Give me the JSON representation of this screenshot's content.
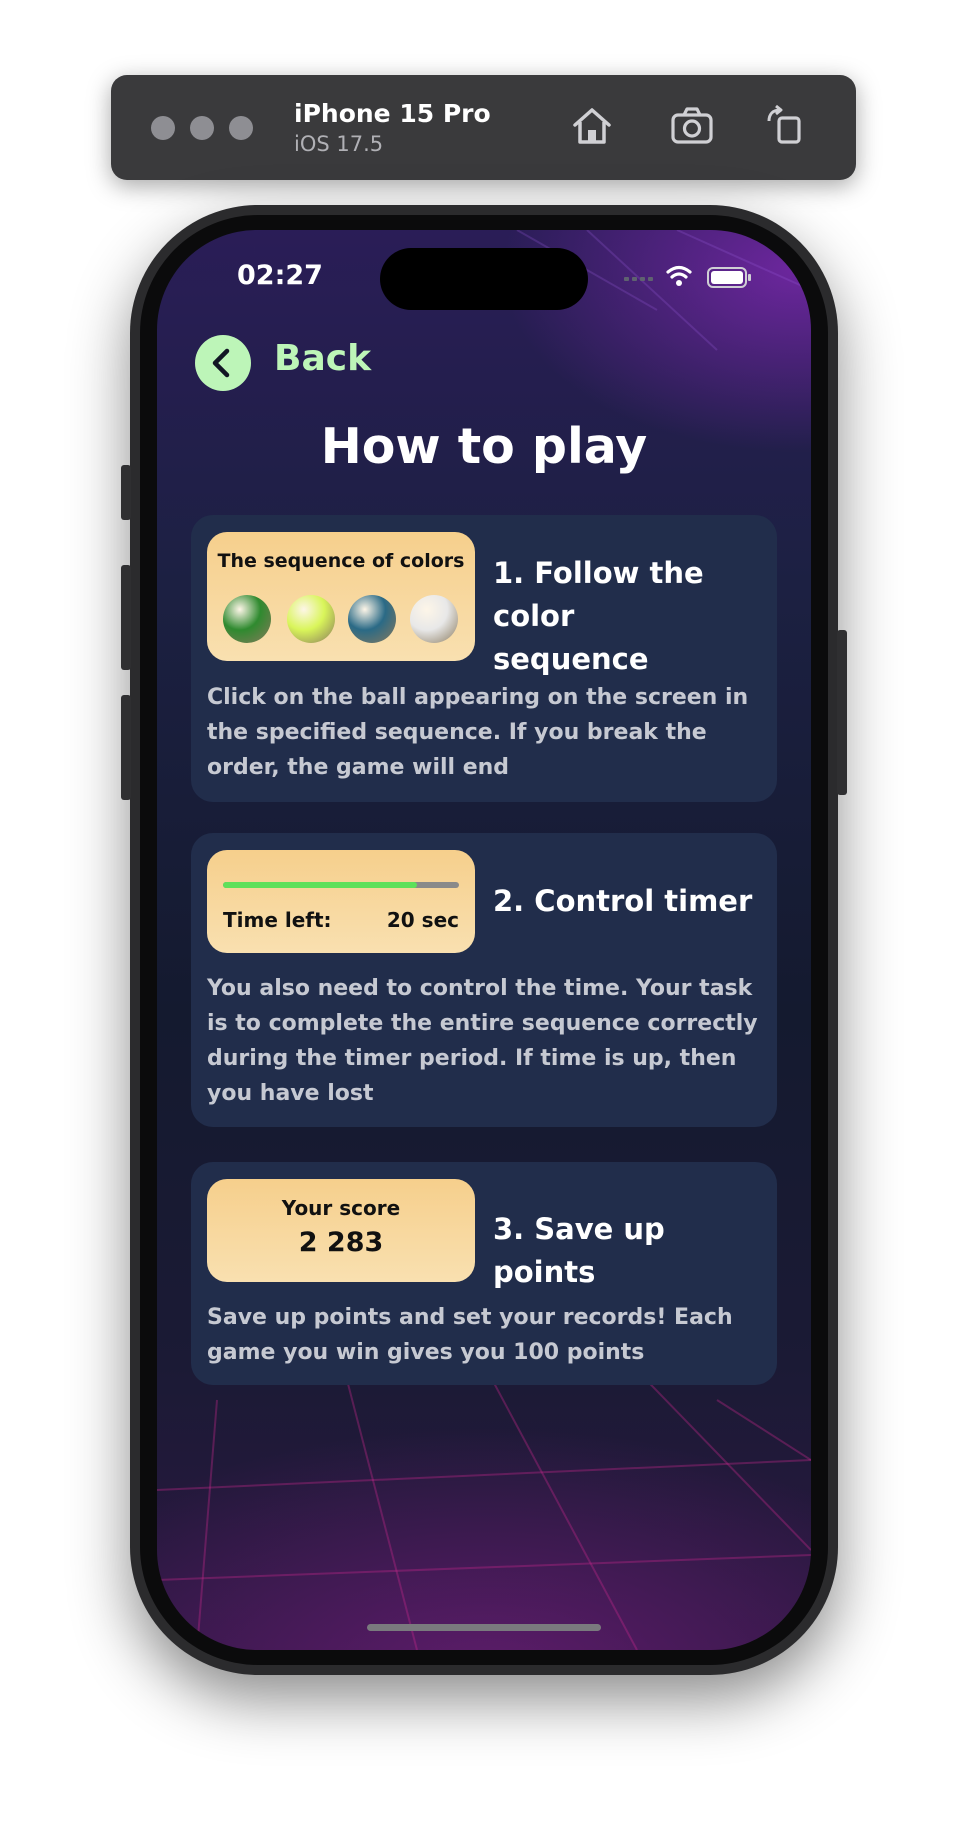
{
  "simulator": {
    "device_name": "iPhone 15 Pro",
    "os_version": "iOS 17.5",
    "icons": [
      "home-icon",
      "screenshot-icon",
      "rotate-icon"
    ]
  },
  "status_bar": {
    "time": "02:27"
  },
  "nav": {
    "back_label": "Back"
  },
  "page": {
    "title": "How to play"
  },
  "cards": [
    {
      "tile_title": "The sequence of colors",
      "ball_colors": [
        "#2f8a2f",
        "#d9f55a",
        "#2a6a86",
        "#e8e8e8"
      ],
      "heading": "1. Follow the color sequence",
      "text": "Click on the ball appearing on the screen in the specified sequence. If you break the order, the game will end"
    },
    {
      "timer_fraction": 0.82,
      "time_left_label": "Time left:",
      "time_left_value": "20 sec",
      "heading": "2. Control timer",
      "text": "You also need to control the time. Your task is to complete the entire sequence correctly during the timer period. If time is up, then you have lost"
    },
    {
      "score_label": "Your score",
      "score_value": "2 283",
      "heading": "3. Save up points",
      "text": "Save up points and set your records! Each game you win gives you 100 points"
    }
  ],
  "colors": {
    "accent_green": "#bdf5b8",
    "card_bg": "#212d4b",
    "tile_gold": "#f6cf8c",
    "timer_fill": "#5fe05a"
  }
}
